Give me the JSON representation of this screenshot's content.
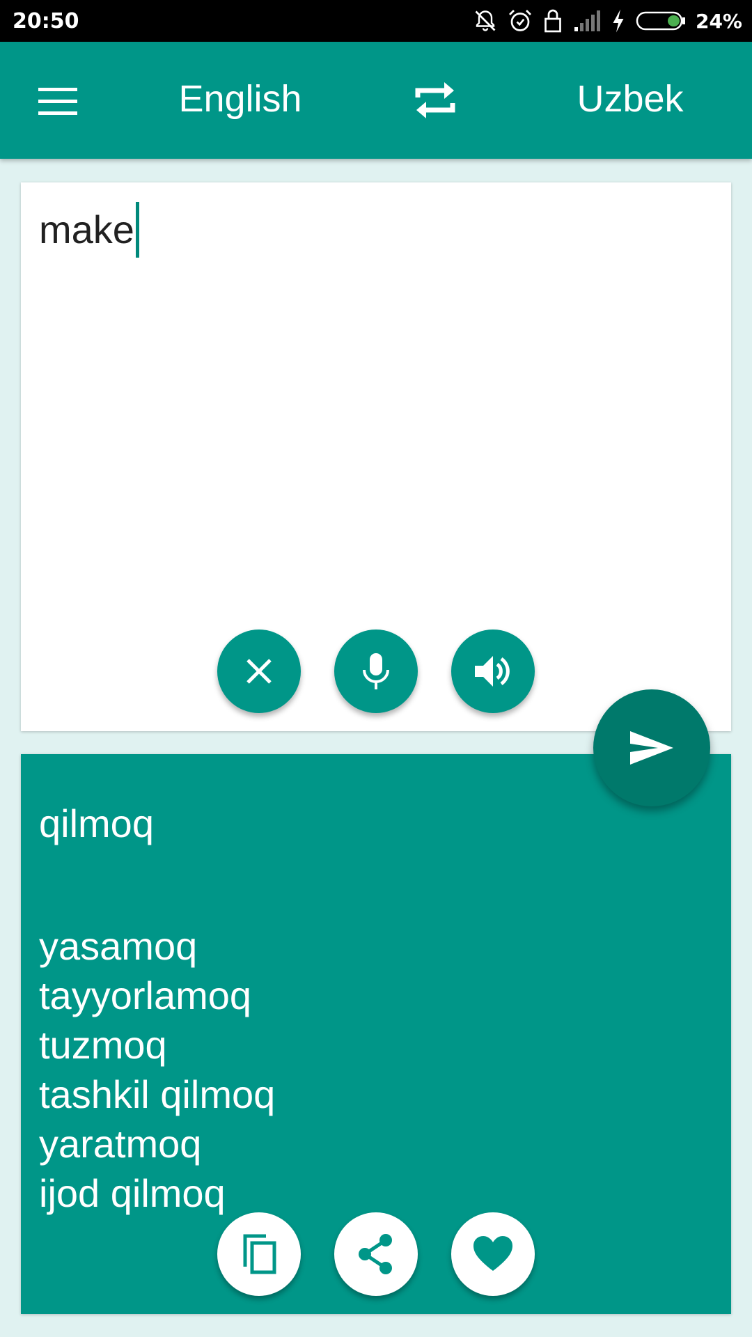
{
  "status_bar": {
    "time": "20:50",
    "battery": "24%",
    "icons": [
      "bell-off-icon",
      "alarm-icon",
      "lock-icon",
      "signal-icon",
      "charging-icon",
      "battery-icon"
    ]
  },
  "toolbar": {
    "menu_icon": "menu-icon",
    "source_language": "English",
    "swap_icon": "swap-icon",
    "target_language": "Uzbek"
  },
  "input": {
    "text": "make",
    "actions": [
      {
        "name": "clear",
        "icon": "close-icon"
      },
      {
        "name": "voice",
        "icon": "mic-icon"
      },
      {
        "name": "speak",
        "icon": "speaker-icon"
      }
    ]
  },
  "translate_button": {
    "icon": "send-icon"
  },
  "output": {
    "main": "qilmoq",
    "alternatives": [
      "yasamoq",
      "tayyorlamoq",
      "tuzmoq",
      "tashkil qilmoq",
      "yaratmoq",
      "ijod qilmoq"
    ],
    "actions": [
      {
        "name": "copy",
        "icon": "copy-icon"
      },
      {
        "name": "share",
        "icon": "share-icon"
      },
      {
        "name": "favorite",
        "icon": "heart-icon"
      }
    ]
  },
  "colors": {
    "primary": "#009688",
    "primary_dark": "#00796b",
    "background": "#e0f2f1",
    "card": "#ffffff",
    "status_bar": "#000000",
    "battery_fill": "#4caf50"
  }
}
